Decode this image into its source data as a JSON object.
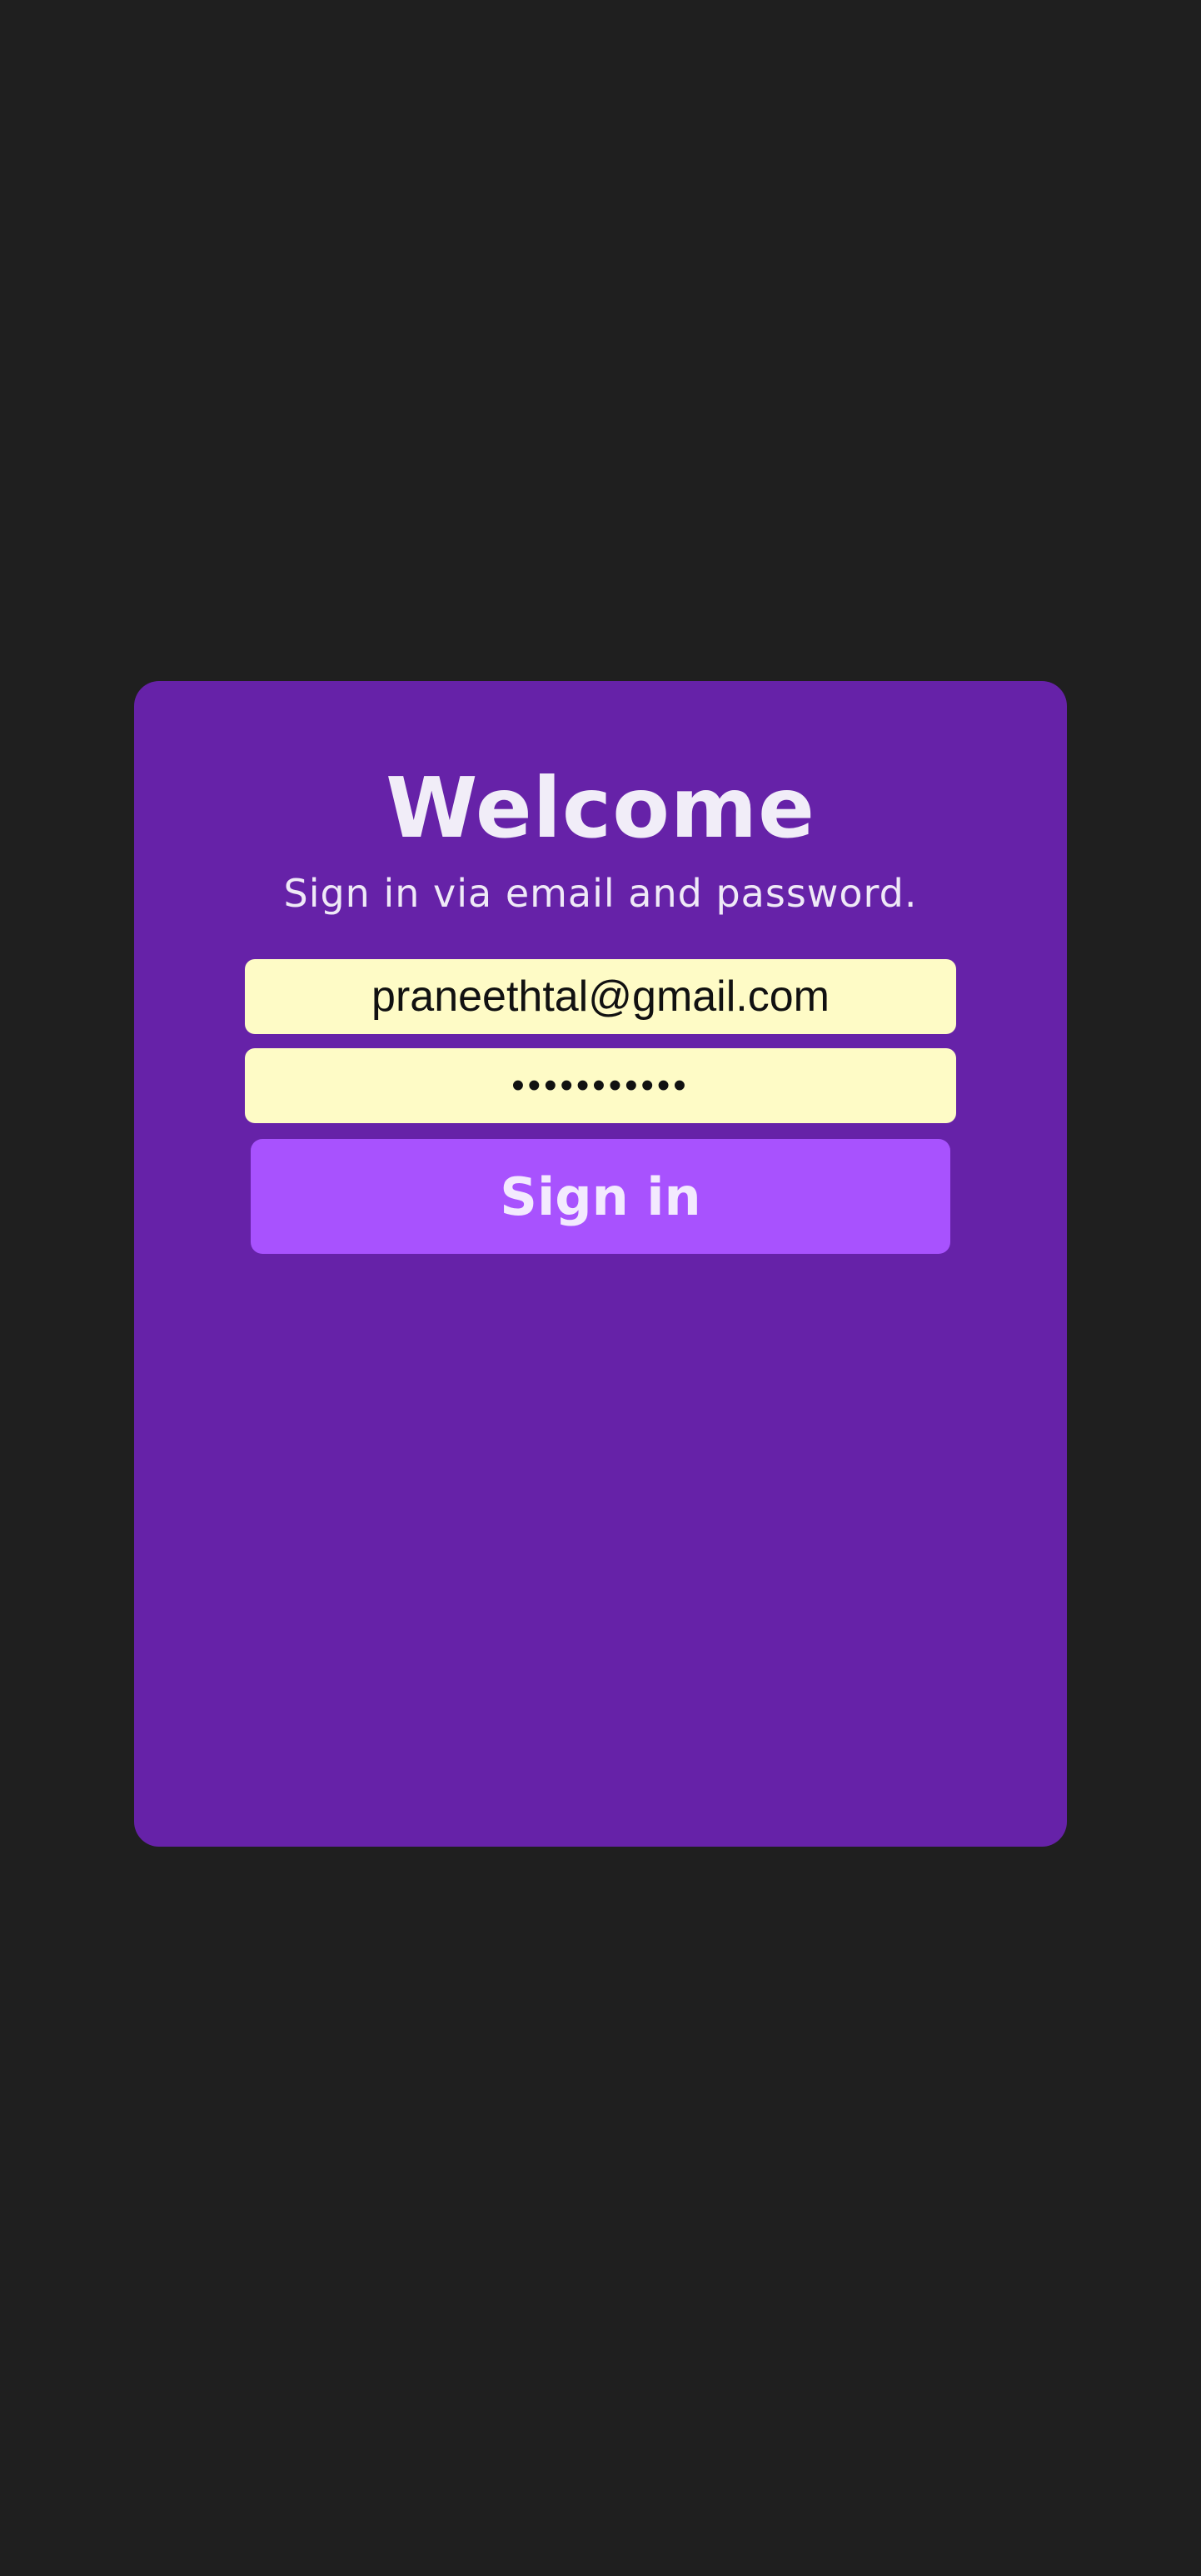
{
  "login_card": {
    "title": "Welcome",
    "subtitle": "Sign in via email and password.",
    "email_value": "praneethtal@gmail.com",
    "password_value": "praneethtal",
    "signin_label": "Sign in"
  },
  "colors": {
    "page_background": "#1f1f1f",
    "card_background": "#6622a8",
    "input_background": "#fefbc6",
    "button_background": "#a852fe",
    "text_light": "#f1edf8"
  }
}
